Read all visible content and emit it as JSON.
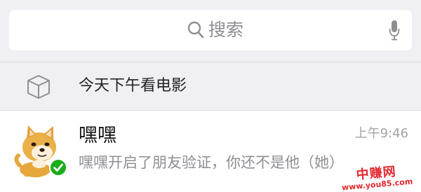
{
  "search": {
    "placeholder": "搜索",
    "search_icon": "search-icon",
    "mic_icon": "microphone-icon"
  },
  "pinned": {
    "icon": "box-icon",
    "label": "今天下午看电影"
  },
  "chats": [
    {
      "name": "嘿嘿",
      "time": "上午9:46",
      "preview": "嘿嘿开启了朋友验证，你还不是他（她）",
      "avatar": "shiba-dog-avatar",
      "badge_icon": "verified-check-icon"
    }
  ],
  "watermark": {
    "line1": "中赚网",
    "line2": "www.you85.com"
  },
  "colors": {
    "background": "#efeff4",
    "watermark": "#e3262d",
    "badge": "#1aad19"
  }
}
